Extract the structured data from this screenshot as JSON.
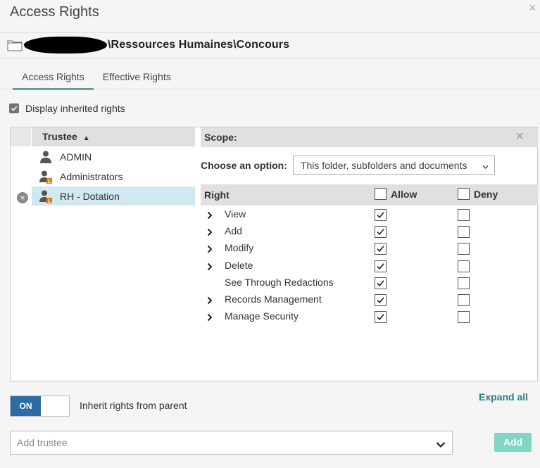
{
  "dialog": {
    "title": "Access Rights",
    "path": "\\Ressources Humaines\\Concours"
  },
  "tabs": [
    {
      "label": "Access Rights",
      "active": true
    },
    {
      "label": "Effective Rights",
      "active": false
    }
  ],
  "display_inherited": {
    "label": "Display inherited rights",
    "checked": true
  },
  "trustees": {
    "header": "Trustee",
    "items": [
      {
        "name": "ADMIN",
        "icon": "user-icon",
        "selected": false
      },
      {
        "name": "Administrators",
        "icon": "group-icon",
        "selected": false
      },
      {
        "name": "RH - Dotation",
        "icon": "group-icon",
        "selected": true
      }
    ]
  },
  "scope": {
    "title": "Scope:",
    "option_label": "Choose an option:",
    "option_value": "This folder, subfolders and documents"
  },
  "rights": {
    "col_right": "Right",
    "col_allow": "Allow",
    "col_deny": "Deny",
    "items": [
      {
        "name": "View",
        "expandable": true,
        "allow": true,
        "deny": false
      },
      {
        "name": "Add",
        "expandable": true,
        "allow": true,
        "deny": false
      },
      {
        "name": "Modify",
        "expandable": true,
        "allow": true,
        "deny": false
      },
      {
        "name": "Delete",
        "expandable": true,
        "allow": true,
        "deny": false
      },
      {
        "name": "See Through Redactions",
        "expandable": false,
        "allow": true,
        "deny": false
      },
      {
        "name": "Records Management",
        "expandable": true,
        "allow": true,
        "deny": false
      },
      {
        "name": "Manage Security",
        "expandable": true,
        "allow": true,
        "deny": false
      }
    ]
  },
  "footer": {
    "expand_all": "Expand all",
    "toggle_state": "ON",
    "inherit_label": "Inherit rights from parent",
    "add_trustee_placeholder": "Add trustee",
    "add_button": "Add"
  },
  "colors": {
    "accent_teal": "#2b8a85",
    "toggle_blue": "#2d6aa6",
    "add_button": "#7fd6c2",
    "selected_row": "#cfe8f1"
  }
}
